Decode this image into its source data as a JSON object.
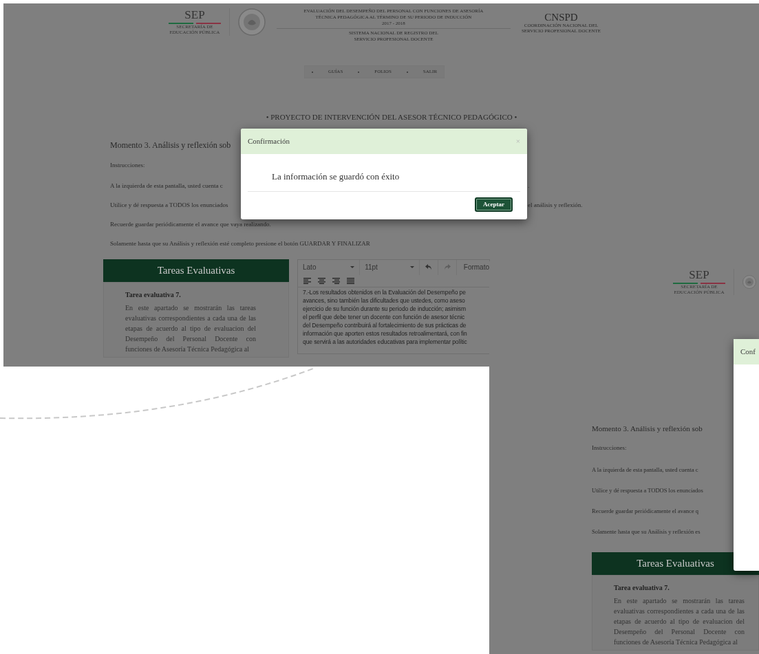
{
  "main_screenshot": {
    "header": {
      "sep": {
        "title": "SEP",
        "subtitle": [
          "SECRETARÍA DE",
          "EDUCACIÓN PÚBLICA"
        ]
      },
      "title_lines": [
        "EVALUACIÓN DEL DESEMPEÑO DEL PERSONAL CON FUNCIONES DE ASESORÍA",
        "TÉCNICA PEDAGÓGICA AL TÉRMINO DE SU PERIODO DE INDUCCIÓN",
        "2017 - 2018"
      ],
      "system_lines": [
        "SISTEMA NACIONAL DE REGISTRO DEL",
        "SERVICIO PROFESIONAL DOCENTE"
      ],
      "cnspd": {
        "title": "CNSPD",
        "subtitle": [
          "COORDINACIÓN NACIONAL DEL",
          "SERVICIO PROFESIONAL DOCENTE"
        ]
      }
    },
    "nav": [
      "GUÍAS",
      "FOLIOS",
      "SALIR"
    ],
    "page_title": "• PROYECTO DE INTERVENCIÓN DEL ASESOR TÉCNICO PEDAGÓGICO •",
    "heading": "Momento 3. Análisis y reflexión sob",
    "instructions_label": "Instrucciones:",
    "instructions": [
      {
        "left": "A la izquierda de esta pantalla, usted cuenta c",
        "right": "."
      },
      {
        "left": "Utilice y dé respuesta a TODOS los enunciados",
        "right": "el análisis y reflexión."
      },
      {
        "left": "Recuerde guardar periódicamente el avance que vaya realizando."
      },
      {
        "left": "Solamente hasta que su Análisis y reflexión esté completo presione el botón GUARDAR Y FINALIZAR"
      }
    ],
    "panel": {
      "title": "Tareas Evaluativas",
      "task_title": "Tarea evaluativa 7.",
      "paragraph": "En este apartado se mostrarán las tareas evaluativas correspondientes a cada una de las etapas de acuerdo al tipo de evaluacion del Desempeño del Personal Docente con funciones de Asesoría Técnica Pedagógica al"
    },
    "editor": {
      "font": "Lato",
      "size": "11pt",
      "format": "Formato",
      "lines": [
        "7.-Los resultados obtenidos en la Evaluación del Desempeño pe",
        "avances, sino también las dificultades que ustedes, como aseso",
        "ejercicio de su función durante su periodo de inducción; asimism",
        "el perfil que debe tener un docente con función de asesor técnic",
        "del Desempeño contribuirá al fortalecimiento de sus prácticas de",
        "información que aporten estos resultados retroalimentará, con fin",
        "que servirá a las autoridades educativas para implementar polític"
      ]
    },
    "modal": {
      "title": "Confirmación",
      "close": "×",
      "message": "La información se guardó con éxito",
      "button": "Aceptar"
    }
  },
  "overlay_screenshot": {
    "sep": {
      "title": "SEP",
      "subtitle": [
        "SECRETARÍA DE",
        "EDUCACIÓN PÚBLICA"
      ]
    },
    "modal_title": "Conf",
    "heading": "Momento 3. Análisis y reflexión sob",
    "instructions_label": "Instrucciones:",
    "instructions": [
      "A la izquierda de esta pantalla, usted cuenta c",
      "Utilice y dé respuesta a TODOS los enunciados",
      "Recuerde guardar periódicamente el avance q",
      "Solamente hasta que su Análisis y reflexión es"
    ],
    "panel": {
      "title": "Tareas Evaluativas",
      "task_title": "Tarea evaluativa 7.",
      "paragraph": "En este apartado se mostrarán las tareas evaluativas correspondientes a cada una de las etapas de acuerdo al tipo de evaluacion del Desempeño del Personal Docente con funciones de Asesoría Técnica Pedagógica al"
    }
  }
}
